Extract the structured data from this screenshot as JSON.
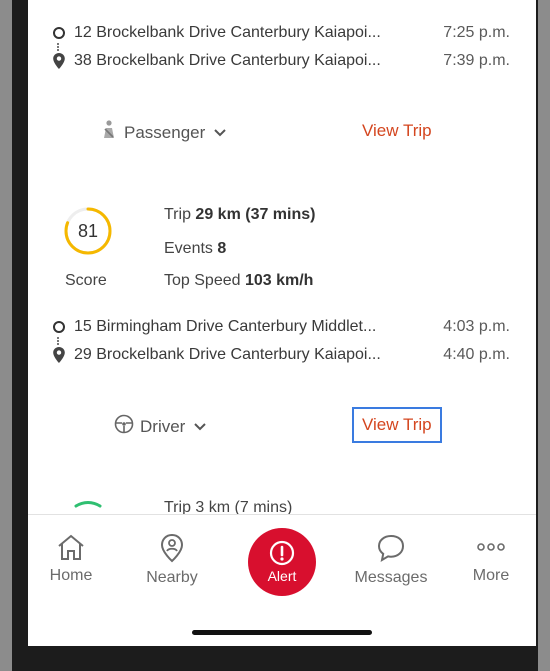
{
  "trips": [
    {
      "start": {
        "address": "12 Brockelbank Drive Canterbury Kaiapoi...",
        "time": "7:25 p.m."
      },
      "end": {
        "address": "38 Brockelbank Drive Canterbury Kaiapoi...",
        "time": "7:39 p.m."
      },
      "role": "Passenger",
      "view_label": "View Trip"
    },
    {
      "score": "81",
      "score_label": "Score",
      "score_color": "#f5b800",
      "score_fraction": 0.81,
      "trip_label": "Trip",
      "trip_value": "29 km (37 mins)",
      "events_label": "Events",
      "events_value": "8",
      "speed_label": "Top Speed",
      "speed_value": "103 km/h",
      "start": {
        "address": "15 Birmingham Drive Canterbury Middlet...",
        "time": "4:03 p.m."
      },
      "end": {
        "address": "29 Brockelbank Drive Canterbury Kaiapoi...",
        "time": "4:40 p.m."
      },
      "role": "Driver",
      "view_label": "View Trip"
    },
    {
      "partial_text": "Trip 3 km (7 mins)",
      "score_color": "#2fbf71"
    }
  ],
  "tabs": {
    "home": "Home",
    "nearby": "Nearby",
    "alert": "Alert",
    "messages": "Messages",
    "more": "More"
  },
  "colors": {
    "accent": "#d4461f",
    "alert": "#d80f2e",
    "focus": "#3a7be0"
  }
}
